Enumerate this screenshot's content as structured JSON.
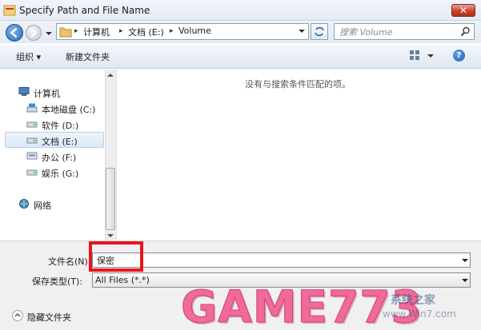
{
  "window": {
    "title": "Specify Path and File Name",
    "close_glyph": "✕"
  },
  "address": {
    "crumbs": [
      "计算机",
      "文档 (E:)",
      "Volume"
    ],
    "separator": "▸"
  },
  "search": {
    "placeholder": "搜索 Volume"
  },
  "toolbar": {
    "organize_label": "组织 ▾",
    "new_folder_label": "新建文件夹",
    "help_glyph": "?"
  },
  "nav": {
    "computer": "计算机",
    "drives": [
      {
        "label": "本地磁盘 (C:)"
      },
      {
        "label": "软件 (D:)"
      },
      {
        "label": "文档 (E:)"
      },
      {
        "label": "办公 (F:)"
      },
      {
        "label": "娱乐 (G:)"
      }
    ],
    "network": "网络"
  },
  "content": {
    "empty_message": "没有与搜索条件匹配的项。"
  },
  "form": {
    "filename_label": "文件名(N):",
    "filename_value": "保密",
    "filetype_label": "保存类型(T):",
    "filetype_value": "All Files (*.*)"
  },
  "footer": {
    "hide_folders_label": "隐藏文件夹"
  },
  "watermark": {
    "brand": "GAME773",
    "line1": "系统之家",
    "line2": "www.Win7.com"
  },
  "colors": {
    "highlight_box": "#e8161b"
  }
}
